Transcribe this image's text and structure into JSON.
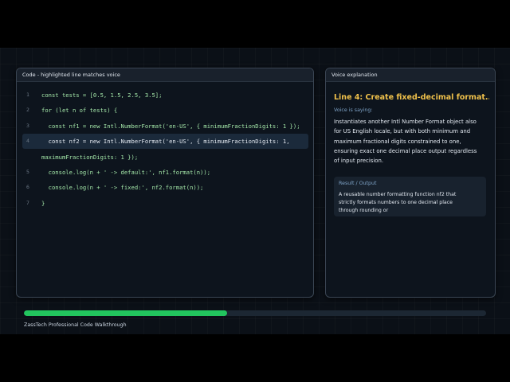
{
  "code_panel": {
    "header": "Code - highlighted line matches voice",
    "highlighted_line": 4,
    "lines": [
      {
        "num": "1",
        "text": "const tests = [0.5, 1.5, 2.5, 3.5];"
      },
      {
        "num": "2",
        "text": "for (let n of tests) {"
      },
      {
        "num": "3",
        "text": "  const nf1 = new Intl.NumberFormat('en-US', { minimumFractionDigits: 1 });"
      },
      {
        "num": "4",
        "text": "  const nf2 = new Intl.NumberFormat('en-US', { minimumFractionDigits: 1,"
      },
      {
        "num": "",
        "text": "maximumFractionDigits: 1 });"
      },
      {
        "num": "5",
        "text": "  console.log(n + ' -> default:', nf1.format(n));"
      },
      {
        "num": "6",
        "text": "  console.log(n + ' -> fixed:', nf2.format(n));"
      },
      {
        "num": "7",
        "text": "}"
      }
    ]
  },
  "voice_panel": {
    "header": "Voice explanation",
    "title": "Line 4: Create fixed-decimal format...",
    "voice_label": "Voice is saying:",
    "description": "Instantiates another Intl Number Format object also for US English locale, but with both minimum and maximum fractional digits constrained to one, ensuring exact one decimal place output regardless of input precision.",
    "result_label": "Result / Output",
    "result_text": "A reusable number formatting function nf2 that strictly formats numbers to one decimal place through rounding or"
  },
  "progress": {
    "fraction": 0.44
  },
  "footer": "ZassTech Professional Code Walkthrough",
  "colors": {
    "accent_title": "#f0c14b",
    "progress": "#22c55e",
    "code_text": "#a3e6a8",
    "highlight_bg": "#1b2a3b"
  }
}
